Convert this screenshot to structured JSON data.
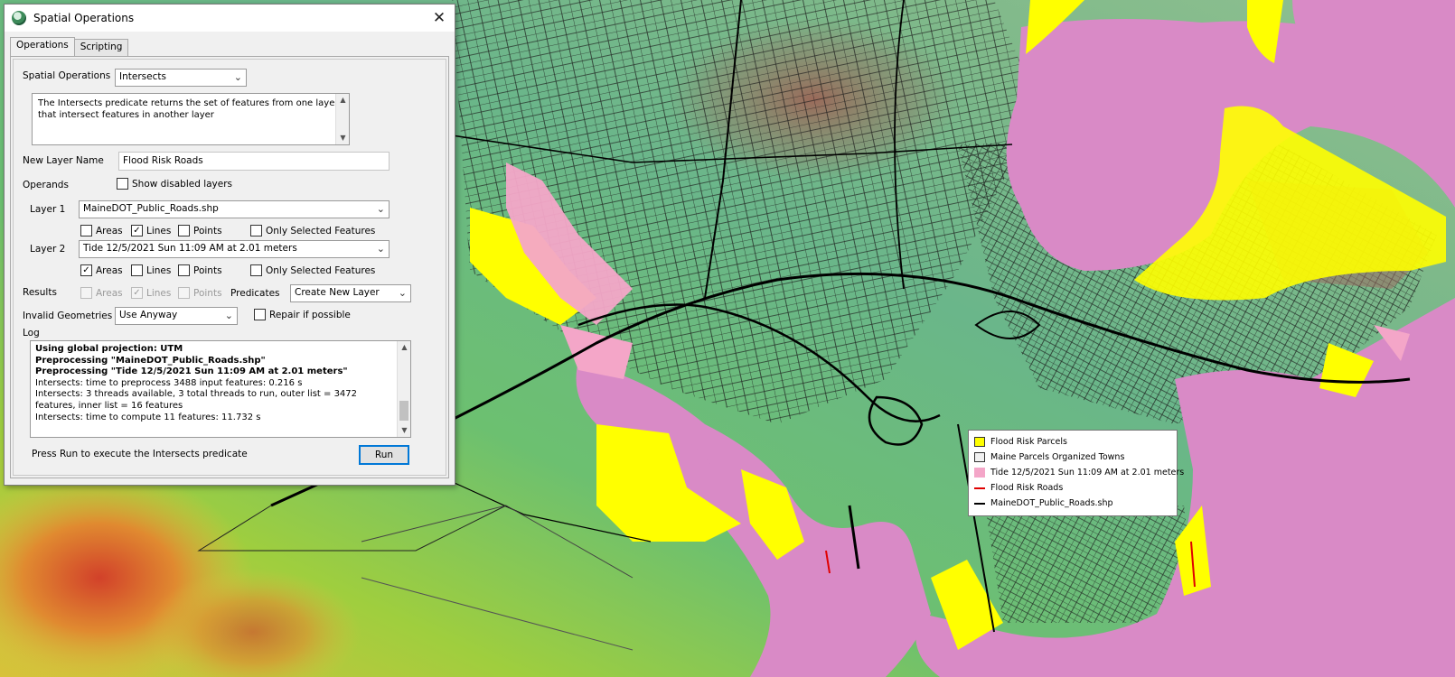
{
  "dialog": {
    "title": "Spatial Operations",
    "close_glyph": "✕",
    "icon": "app-globe-icon",
    "tabs": [
      {
        "label": "Operations",
        "active": true
      },
      {
        "label": "Scripting",
        "active": false
      }
    ],
    "operation": {
      "label": "Spatial Operations",
      "value": "Intersects"
    },
    "description": "The Intersects predicate returns the set of features from one layer that intersect features in another layer",
    "new_layer": {
      "label": "New Layer Name",
      "value": "Flood Risk Roads"
    },
    "operands": {
      "label": "Operands",
      "show_disabled_label": "Show disabled layers",
      "show_disabled_checked": false
    },
    "layer1": {
      "label": "Layer 1",
      "value": "MaineDOT_Public_Roads.shp",
      "areas": {
        "label": "Areas",
        "checked": false
      },
      "lines": {
        "label": "Lines",
        "checked": true
      },
      "points": {
        "label": "Points",
        "checked": false
      },
      "only_selected": {
        "label": "Only Selected Features",
        "checked": false
      }
    },
    "layer2": {
      "label": "Layer 2",
      "value": "Tide 12/5/2021 Sun 11:09 AM at 2.01 meters",
      "areas": {
        "label": "Areas",
        "checked": true
      },
      "lines": {
        "label": "Lines",
        "checked": false
      },
      "points": {
        "label": "Points",
        "checked": false
      },
      "only_selected": {
        "label": "Only Selected Features",
        "checked": false
      }
    },
    "results": {
      "label": "Results",
      "areas": {
        "label": "Areas",
        "checked": false
      },
      "lines": {
        "label": "Lines",
        "checked": true
      },
      "points": {
        "label": "Points",
        "checked": false
      },
      "predicates_label": "Predicates",
      "predicates_value": "Create New Layer"
    },
    "invalid_geometries": {
      "label": "Invalid Geometries",
      "value": "Use Anyway",
      "repair_label": "Repair if possible",
      "repair_checked": false
    },
    "log": {
      "label": "Log",
      "lines": [
        "Using global projection: UTM",
        "Preprocessing \"MaineDOT_Public_Roads.shp\"",
        "Preprocessing \"Tide 12/5/2021 Sun 11:09 AM at 2.01 meters\"",
        "Intersects: time to preprocess 3488 input features: 0.216 s",
        "Intersects: 3 threads available, 3 total threads to run, outer list = 3472 features, inner list = 16 features",
        "Intersects: time to compute 11 features: 11.732 s"
      ]
    },
    "status": "Press Run to execute the Intersects predicate",
    "run_label": "Run"
  },
  "legend": {
    "items": [
      {
        "label": "Flood Risk Parcels",
        "kind": "box",
        "color": "#ffff00"
      },
      {
        "label": "Maine Parcels Organized Towns",
        "kind": "box",
        "color": "#f2f2f2"
      },
      {
        "label": "Tide 12/5/2021 Sun 11:09 AM at 2.01 meters",
        "kind": "box",
        "color": "#f4a6c8"
      },
      {
        "label": "Flood Risk Roads",
        "kind": "line",
        "color": "#e00000"
      },
      {
        "label": "MaineDOT_Public_Roads.shp",
        "kind": "line",
        "color": "#000000"
      }
    ]
  },
  "colors": {
    "water": "#d98ac6",
    "flood_parcels": "#ffff00",
    "tide_pink": "#f4a6c8",
    "roads": "#000000",
    "flood_roads": "#e00000",
    "accent": "#0078d7"
  }
}
